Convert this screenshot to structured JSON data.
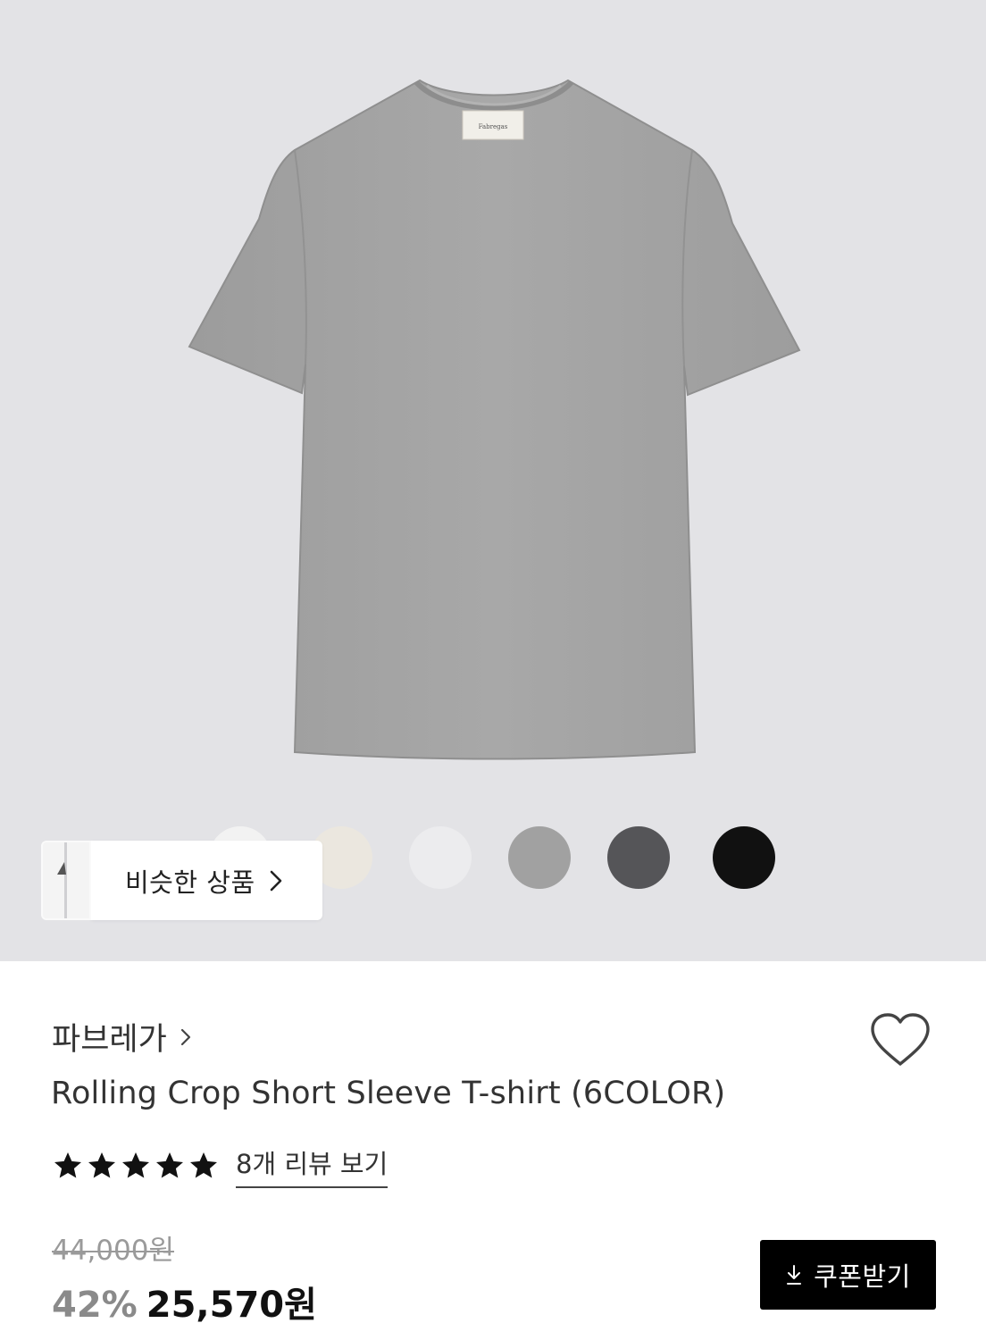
{
  "similar": {
    "label": "비슷한 상품"
  },
  "brand": {
    "name": "파브레가"
  },
  "product": {
    "title": "Rolling Crop Short Sleeve T-shirt (6COLOR)"
  },
  "rating": {
    "stars": 5,
    "review_link": "8개 리뷰 보기"
  },
  "price": {
    "original": "44,000원",
    "discount": "42%",
    "sale": "25,570원"
  },
  "coupon": {
    "label": "쿠폰받기"
  },
  "image": {
    "shirt_label_text": "Fabregas",
    "color_swatches": [
      "white",
      "oatmeal",
      "light-gray",
      "melange-gray",
      "charcoal",
      "black"
    ]
  },
  "colors": {
    "hero_bg": "#e3e3e6",
    "shirt": "#a3a3a3",
    "coupon_bg": "#000000",
    "discount": "#8a8a8a"
  }
}
